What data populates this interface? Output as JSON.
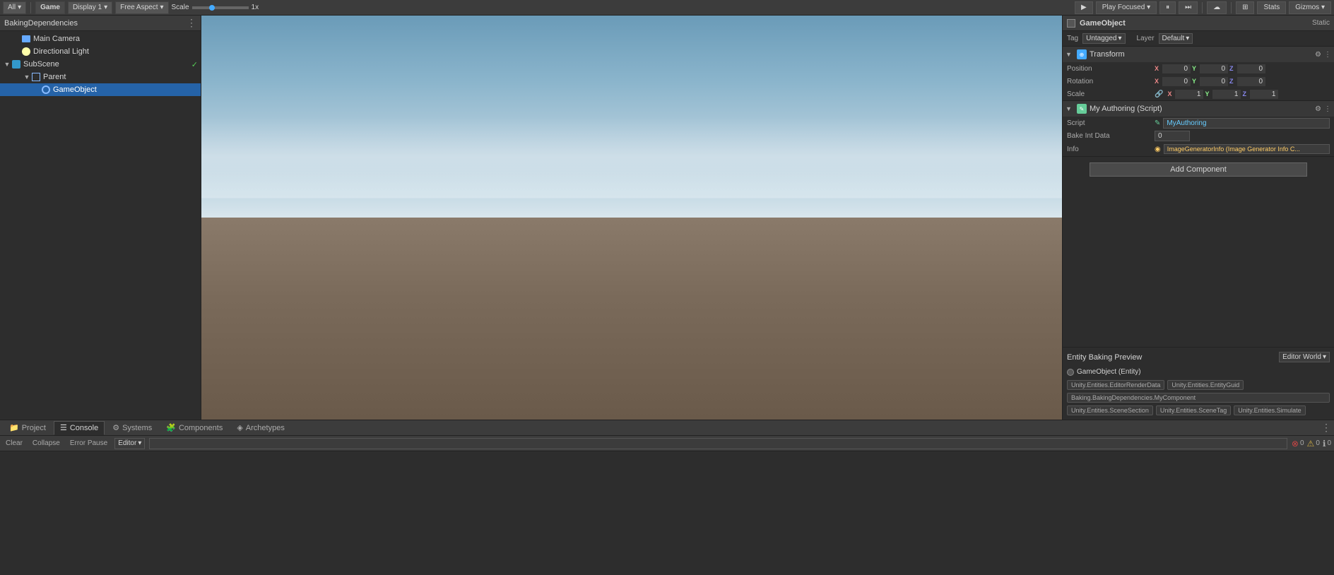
{
  "topToolbar": {
    "all_label": "All",
    "game_label": "Game",
    "display_label": "Display 1",
    "aspect_label": "Free Aspect",
    "scale_label": "Scale",
    "scale_value": "1x",
    "play_label": "Play Focused",
    "stats_label": "Stats",
    "gizmos_label": "Gizmos"
  },
  "hierarchy": {
    "title": "BakingDependencies",
    "items": [
      {
        "id": "main-camera",
        "label": "Main Camera",
        "indent": 1,
        "type": "camera",
        "arrow": ""
      },
      {
        "id": "dir-light",
        "label": "Directional Light",
        "indent": 1,
        "type": "light",
        "arrow": ""
      },
      {
        "id": "subscene",
        "label": "SubScene",
        "indent": 0,
        "type": "subscene",
        "arrow": "▼",
        "checked": true
      },
      {
        "id": "parent",
        "label": "Parent",
        "indent": 1,
        "type": "parent",
        "arrow": "▼"
      },
      {
        "id": "gameobject",
        "label": "GameObject",
        "indent": 2,
        "type": "gameobj",
        "arrow": "",
        "selected": true
      }
    ]
  },
  "inspector": {
    "obj_name": "GameObject",
    "static_label": "Static",
    "tag_label": "Tag",
    "tag_value": "Untagged",
    "layer_label": "Layer",
    "layer_value": "Default",
    "transform": {
      "title": "Transform",
      "position_label": "Position",
      "rotation_label": "Rotation",
      "scale_label": "Scale",
      "pos_x": "0",
      "pos_y": "0",
      "pos_z": "0",
      "rot_x": "0",
      "rot_y": "0",
      "rot_z": "0",
      "scale_x": "1",
      "scale_y": "1",
      "scale_z": "1"
    },
    "authoring": {
      "title": "My Authoring (Script)",
      "script_label": "Script",
      "script_value": "MyAuthoring",
      "bake_int_label": "Bake Int Data",
      "bake_int_value": "0",
      "info_label": "Info",
      "info_value": "ImageGeneratorInfo (Image Generator Info C..."
    },
    "add_component_label": "Add Component"
  },
  "entityBaking": {
    "title": "Entity Baking Preview",
    "world_label": "Editor World",
    "entity_name": "GameObject (Entity)",
    "tags": [
      "Unity.Entities.EditorRenderData",
      "Unity.Entities.EntityGuid",
      "Baking.BakingDependencies.MyComponent",
      "Unity.Entities.SceneSection",
      "Unity.Entities.SceneTag",
      "Unity.Entities.Simulate"
    ]
  },
  "bottomTabs": [
    {
      "id": "project",
      "label": "Project",
      "icon": "📁",
      "active": false
    },
    {
      "id": "console",
      "label": "Console",
      "icon": "☰",
      "active": true
    },
    {
      "id": "systems",
      "label": "Systems",
      "icon": "⚙",
      "active": false
    },
    {
      "id": "components",
      "label": "Components",
      "icon": "🧩",
      "active": false
    },
    {
      "id": "archetypes",
      "label": "Archetypes",
      "icon": "◈",
      "active": false
    }
  ],
  "consoleToolbar": {
    "clear_label": "Clear",
    "collapse_label": "Collapse",
    "error_pause_label": "Error Pause",
    "editor_label": "Editor",
    "search_placeholder": "",
    "error_count": "0",
    "warn_count": "0",
    "info_count": "0"
  }
}
